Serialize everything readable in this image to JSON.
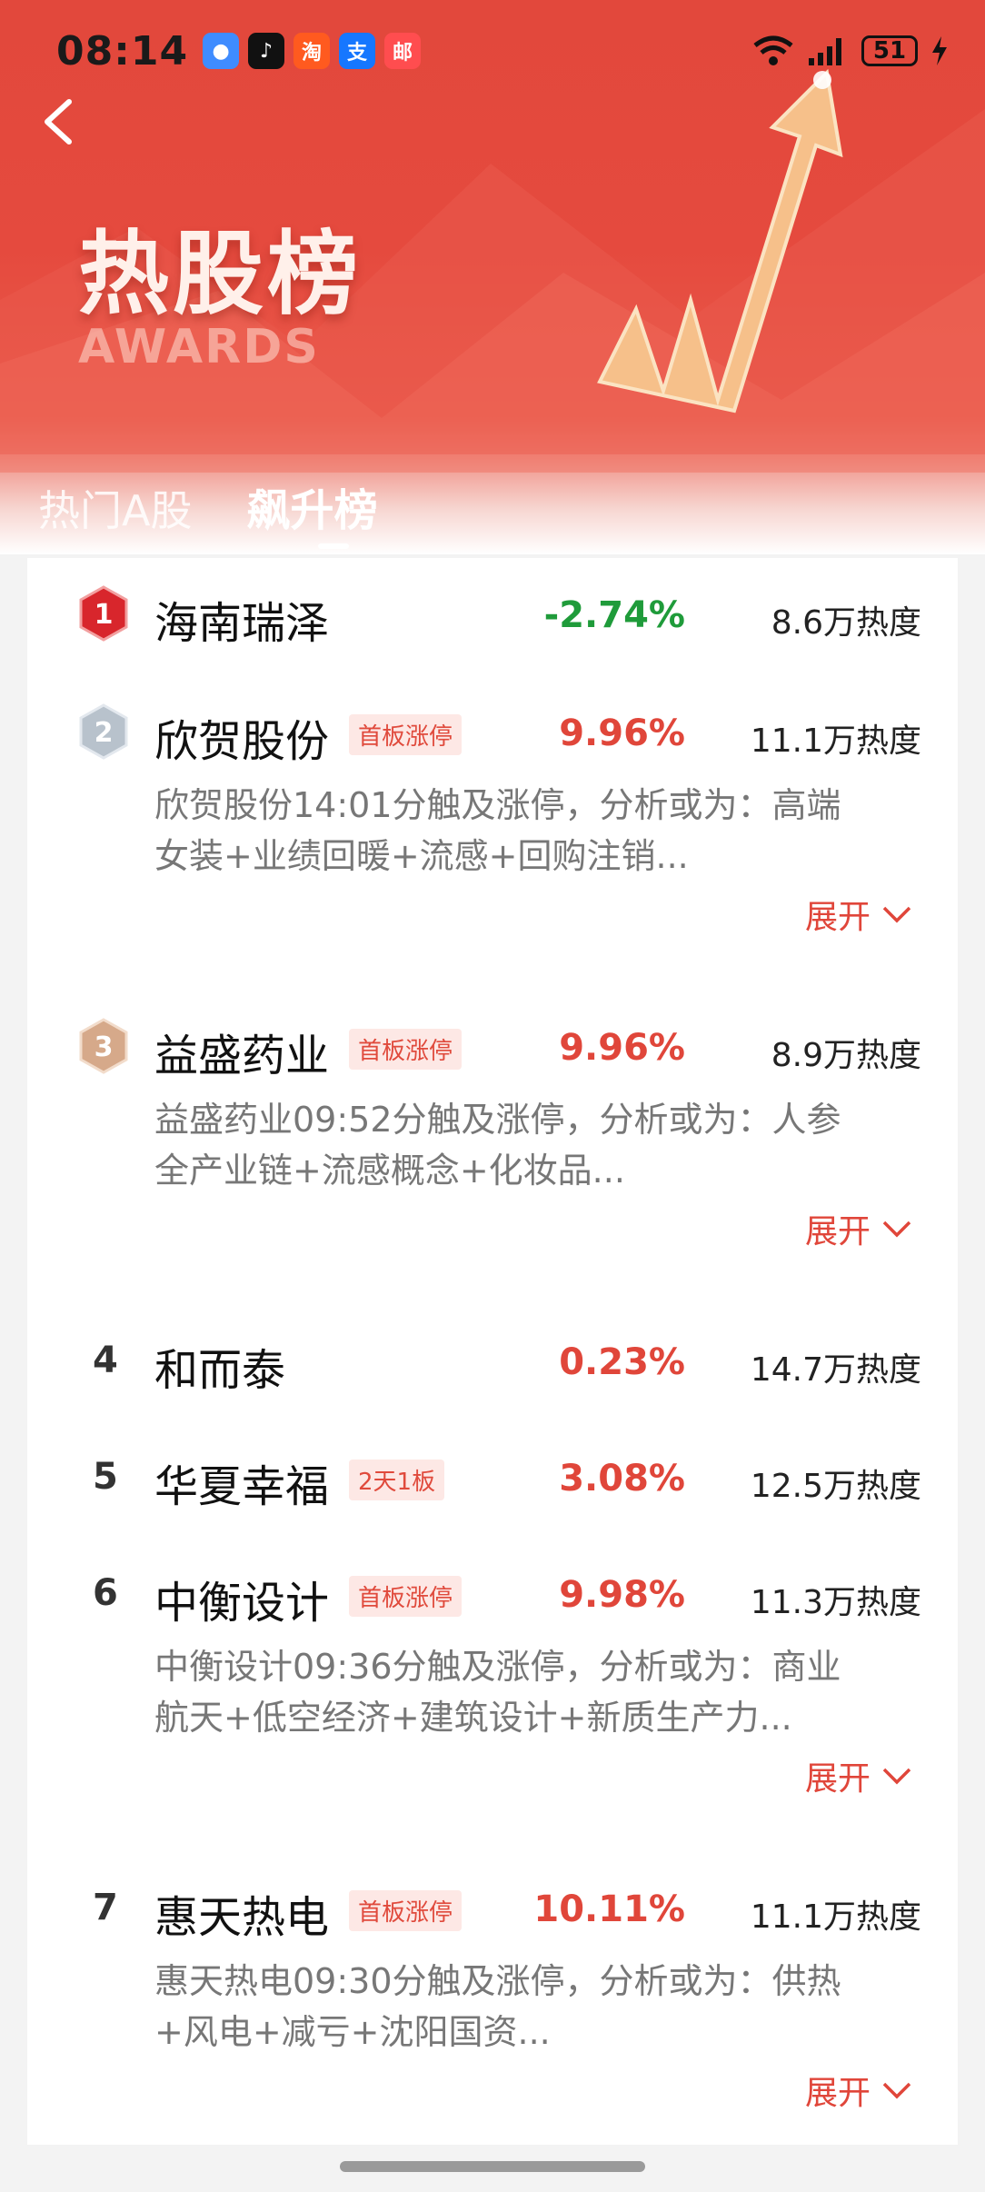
{
  "status_bar": {
    "time": "08:14",
    "battery": "51",
    "apps": [
      {
        "icon": "messages-icon",
        "glyph": "●",
        "color": "#3f8cff"
      },
      {
        "icon": "douyin-icon",
        "glyph": "♪",
        "color": "#111111"
      },
      {
        "icon": "taobao-icon",
        "glyph": "淘",
        "color": "#ff5a1f"
      },
      {
        "icon": "alipay-icon",
        "glyph": "支",
        "color": "#1677ff"
      },
      {
        "icon": "mail-icon",
        "glyph": "邮",
        "color": "#ff4d4f"
      }
    ]
  },
  "header": {
    "title": "热股榜",
    "subtitle": "AWARDS",
    "tabs": [
      "热门A股",
      "飙升榜"
    ],
    "active_tab": "飙升榜"
  },
  "colors": {
    "up": "#e0463a",
    "down": "#1f9b3a",
    "accent": "#e54a3e"
  },
  "stocks": [
    {
      "rank": "1",
      "name": "海南瑞泽",
      "tag": "",
      "change": "-2.74%",
      "direction": "down",
      "heat": "8.6万热度",
      "desc1": "",
      "desc2": "",
      "expand": ""
    },
    {
      "rank": "2",
      "name": "欣贺股份",
      "tag": "首板涨停",
      "change": "9.96%",
      "direction": "up",
      "heat": "11.1万热度",
      "desc1": "欣贺股份14:01分触及涨停，分析或为：高端",
      "desc2": "女装+业绩回暖+流感+回购注销...",
      "expand": "展开"
    },
    {
      "rank": "3",
      "name": "益盛药业",
      "tag": "首板涨停",
      "change": "9.96%",
      "direction": "up",
      "heat": "8.9万热度",
      "desc1": "益盛药业09:52分触及涨停，分析或为：人参",
      "desc2": "全产业链+流感概念+化妆品...",
      "expand": "展开"
    },
    {
      "rank": "4",
      "name": "和而泰",
      "tag": "",
      "change": "0.23%",
      "direction": "up",
      "heat": "14.7万热度",
      "desc1": "",
      "desc2": "",
      "expand": ""
    },
    {
      "rank": "5",
      "name": "华夏幸福",
      "tag": "2天1板",
      "change": "3.08%",
      "direction": "up",
      "heat": "12.5万热度",
      "desc1": "",
      "desc2": "",
      "expand": ""
    },
    {
      "rank": "6",
      "name": "中衡设计",
      "tag": "首板涨停",
      "change": "9.98%",
      "direction": "up",
      "heat": "11.3万热度",
      "desc1": "中衡设计09:36分触及涨停，分析或为：商业",
      "desc2": "航天+低空经济+建筑设计+新质生产力...",
      "expand": "展开"
    },
    {
      "rank": "7",
      "name": "惠天热电",
      "tag": "首板涨停",
      "change": "10.11%",
      "direction": "up",
      "heat": "11.1万热度",
      "desc1": "惠天热电09:30分触及涨停，分析或为：供热",
      "desc2": "+风电+减亏+沈阳国资...",
      "expand": "展开"
    }
  ]
}
